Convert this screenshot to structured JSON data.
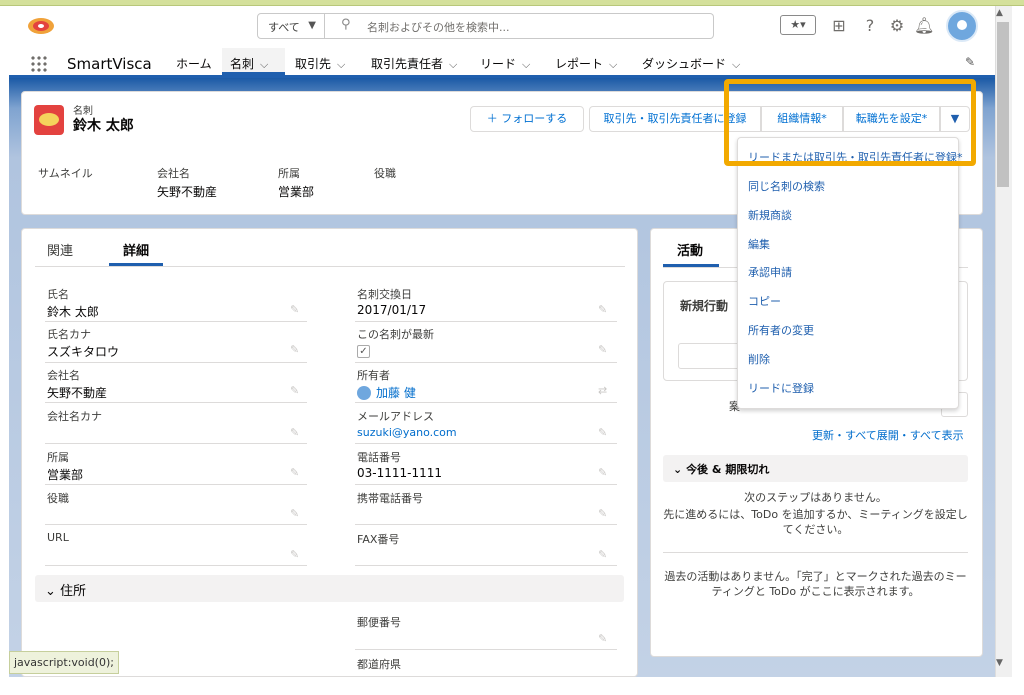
{
  "header": {
    "scope": "すべて",
    "search_placeholder": "名刺およびその他を検索中..."
  },
  "nav": {
    "app_name": "SmartVisca",
    "items": [
      {
        "label": "ホーム"
      },
      {
        "label": "名刺"
      },
      {
        "label": "取引先"
      },
      {
        "label": "取引先責任者"
      },
      {
        "label": "リード"
      },
      {
        "label": "レポート"
      },
      {
        "label": "ダッシュボード"
      }
    ]
  },
  "record": {
    "type": "名刺",
    "title": "鈴木 太郎",
    "buttons": {
      "follow": "＋ フォローする",
      "action1": "取引先・取引先責任者に登録",
      "action2": "組織情報*",
      "action3": "転職先を設定*"
    },
    "highlights": [
      {
        "label": "サムネイル",
        "value": ""
      },
      {
        "label": "会社名",
        "value": "矢野不動産"
      },
      {
        "label": "所属",
        "value": "営業部"
      },
      {
        "label": "役職",
        "value": ""
      }
    ]
  },
  "details": {
    "tabs": [
      "関連",
      "詳細"
    ],
    "left_fields": [
      {
        "label": "氏名",
        "value": "鈴木 太郎"
      },
      {
        "label": "氏名カナ",
        "value": "スズキタロウ"
      },
      {
        "label": "会社名",
        "value": "矢野不動産"
      },
      {
        "label": "会社名カナ",
        "value": ""
      },
      {
        "label": "所属",
        "value": "営業部"
      },
      {
        "label": "役職",
        "value": ""
      },
      {
        "label": "URL",
        "value": ""
      }
    ],
    "right_fields": [
      {
        "label": "名刺交換日",
        "value": "2017/01/17"
      },
      {
        "label": "この名刺が最新",
        "value": "✓"
      },
      {
        "label": "所有者",
        "value": "加藤 健"
      },
      {
        "label": "メールアドレス",
        "value": "suzuki@yano.com"
      },
      {
        "label": "電話番号",
        "value": "03-1111-1111"
      },
      {
        "label": "携帯電話番号",
        "value": ""
      },
      {
        "label": "FAX番号",
        "value": ""
      }
    ],
    "address_section": "住所",
    "address_fields": [
      {
        "label": "郵便番号"
      },
      {
        "label": "都道府県"
      }
    ]
  },
  "activity": {
    "tab": "活動",
    "new_action": "新規行動",
    "partial_text": "案",
    "links": "更新・すべて展開・すべて表示",
    "upcoming": "今後 & 期限切れ",
    "no_steps": "次のステップはありません。",
    "no_steps_hint": "先に進めるには、ToDo を追加するか、ミーティングを設定してください。",
    "past_none": "過去の活動はありません。「完了」とマークされた過去のミーティングと ToDo がここに表示されます。"
  },
  "dropdown": {
    "items": [
      "リードまたは取引先・取引先責任者に登録*",
      "同じ名刺の検索",
      "新規商談",
      "編集",
      "承認申請",
      "コピー",
      "所有者の変更",
      "削除",
      "リードに登録"
    ]
  },
  "status_bar": "javascript:void(0);",
  "colors": {
    "brand": "#1f5fae",
    "highlight_box": "#f2a900",
    "link": "#006dcc"
  }
}
